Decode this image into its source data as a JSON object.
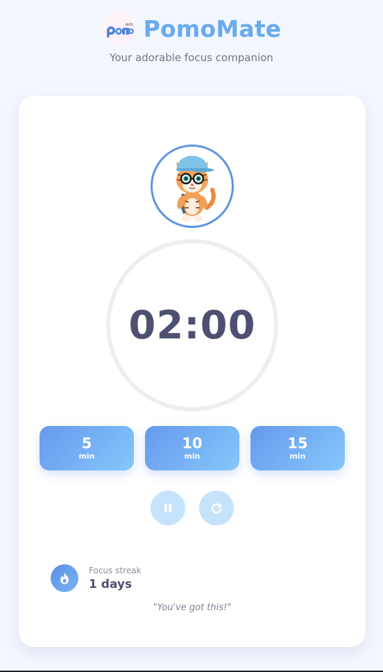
{
  "header": {
    "brand": "PomoMate",
    "logo_text": "pomo",
    "tagline": "Your adorable focus companion"
  },
  "timer": {
    "display": "02:00"
  },
  "presets": [
    {
      "value": "5",
      "unit": "min"
    },
    {
      "value": "10",
      "unit": "min"
    },
    {
      "value": "15",
      "unit": "min"
    }
  ],
  "controls": {
    "pause_icon": "pause-icon",
    "reset_icon": "reset-icon"
  },
  "streak": {
    "label": "Focus streak",
    "value": "1 days",
    "icon": "flame-icon"
  },
  "quote": "\"You've got this!\"",
  "colors": {
    "brand": "#6aaaf0",
    "accent": "#5d93e6",
    "background": "#f2f6fd",
    "timer_text": "#4d5070"
  }
}
